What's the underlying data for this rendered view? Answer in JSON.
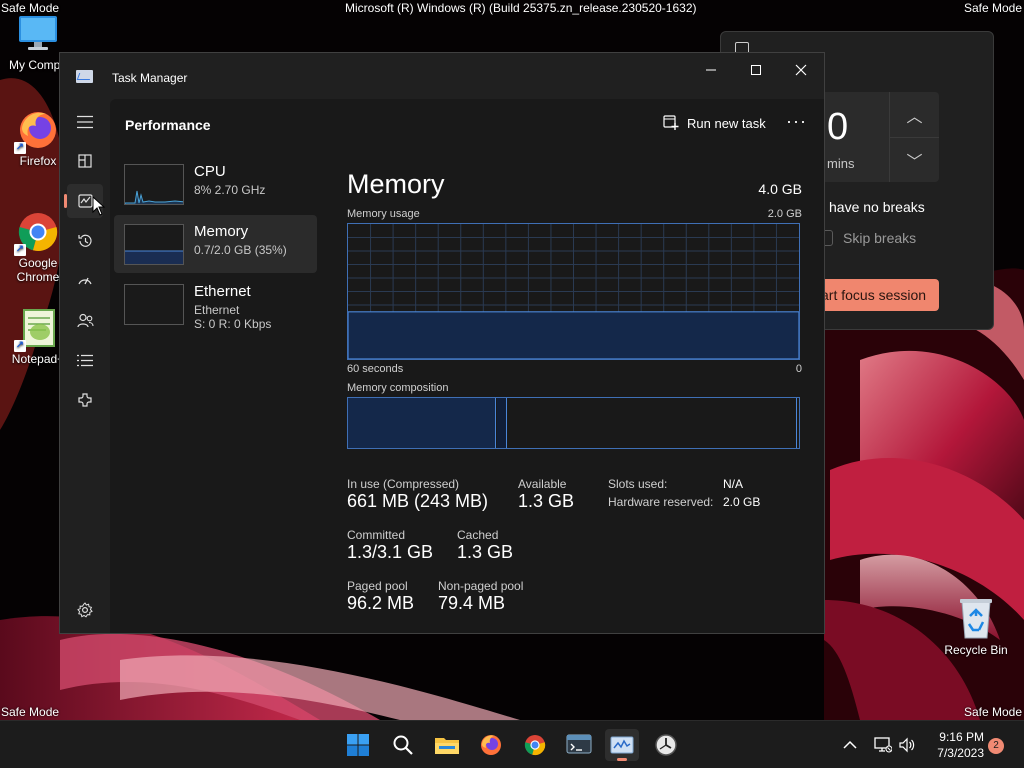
{
  "system": {
    "safe_mode_label": "Safe Mode",
    "build_title": "Microsoft (R) Windows (R) (Build 25375.zn_release.230520-1632)"
  },
  "desktop_icons": [
    {
      "label": "My Compu",
      "icon": "computer-icon"
    },
    {
      "label": "Firefox",
      "icon": "firefox-icon"
    },
    {
      "label": "Google\nChrome",
      "icon": "chrome-icon"
    },
    {
      "label": "Notepad+",
      "icon": "notepad-plus-plus-icon"
    },
    {
      "label": "Recycle Bin",
      "icon": "recycle-bin-icon"
    }
  ],
  "focus_widget": {
    "time_value": "0",
    "time_unit": "mins",
    "no_breaks": "have no breaks",
    "skip_breaks": "Skip breaks",
    "start_button": "art focus session"
  },
  "task_manager": {
    "title": "Task Manager",
    "page_title": "Performance",
    "run_new_task": "Run new task",
    "nav_items": [
      "menu-icon",
      "processes-icon",
      "performance-icon",
      "app-history-icon",
      "startup-apps-icon",
      "users-icon",
      "details-icon",
      "services-icon",
      "settings-icon"
    ],
    "resources": [
      {
        "name": "CPU",
        "sub": "8%  2.70 GHz"
      },
      {
        "name": "Memory",
        "sub": "0.7/2.0 GB (35%)"
      },
      {
        "name": "Ethernet",
        "sub1": "Ethernet",
        "sub2": "S: 0  R: 0 Kbps"
      }
    ],
    "memory": {
      "title": "Memory",
      "total": "4.0 GB",
      "usage_label": "Memory usage",
      "usage_max": "2.0 GB",
      "x_left": "60 seconds",
      "x_right": "0",
      "usage_fraction": 0.35,
      "composition_label": "Memory composition",
      "stats": {
        "in_use_label": "In use (Compressed)",
        "in_use_value": "661 MB (243 MB)",
        "available_label": "Available",
        "available_value": "1.3 GB",
        "committed_label": "Committed",
        "committed_value": "1.3/3.1 GB",
        "cached_label": "Cached",
        "cached_value": "1.3 GB",
        "paged_label": "Paged pool",
        "paged_value": "96.2 MB",
        "nonpaged_label": "Non-paged pool",
        "nonpaged_value": "79.4 MB",
        "slots_label": "Slots used:",
        "slots_value": "N/A",
        "hw_reserved_label": "Hardware reserved:",
        "hw_reserved_value": "2.0 GB"
      }
    }
  },
  "taskbar": {
    "apps": [
      "start-icon",
      "search-icon",
      "file-explorer-icon",
      "firefox-icon",
      "chrome-icon",
      "terminal-icon",
      "task-manager-icon",
      "clock-app-icon"
    ],
    "time": "9:16 PM",
    "date": "7/3/2023",
    "notification_count": "2"
  },
  "colors": {
    "accent": "#f08a73",
    "graph_line": "#4a86d8",
    "graph_fill": "#14284a"
  }
}
